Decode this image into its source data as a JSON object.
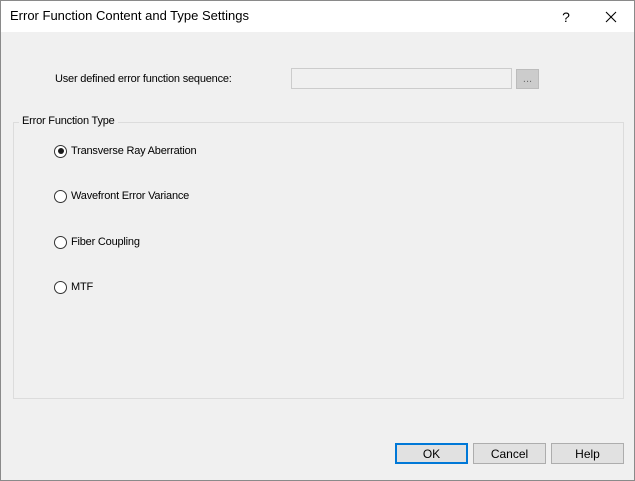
{
  "window": {
    "title": "Error Function Content and Type Settings",
    "help_glyph": "?",
    "close_glyph": "✕"
  },
  "sequence": {
    "label": "User defined error function sequence:",
    "value": "",
    "placeholder": "",
    "browse_label": "..."
  },
  "error_type_group": {
    "legend": "Error Function Type",
    "options": [
      {
        "label": "Transverse Ray Aberration",
        "selected": true
      },
      {
        "label": "Wavefront Error Variance",
        "selected": false
      },
      {
        "label": "Fiber Coupling",
        "selected": false
      },
      {
        "label": "MTF",
        "selected": false
      }
    ]
  },
  "buttons": {
    "ok": "OK",
    "cancel": "Cancel",
    "help": "Help"
  },
  "colors": {
    "dialog_bg": "#f0f0f0",
    "titlebar_bg": "#ffffff",
    "default_button_border": "#0078d7"
  }
}
